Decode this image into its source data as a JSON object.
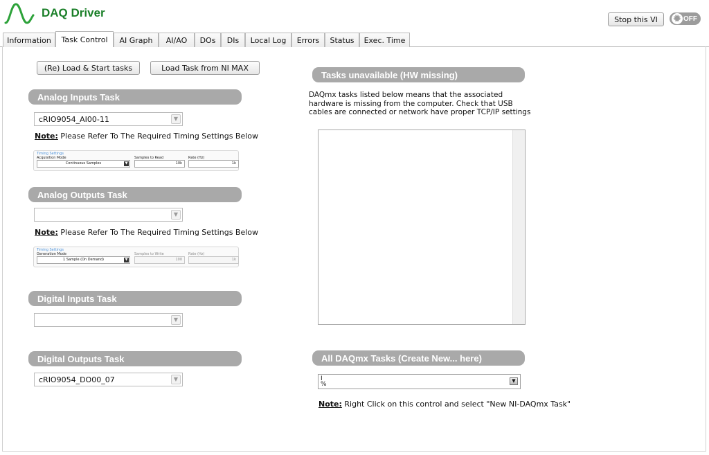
{
  "header": {
    "title": "DAQ Driver",
    "stop_button": "Stop this VI",
    "power_toggle": "OFF"
  },
  "tabs": [
    {
      "label": "Information"
    },
    {
      "label": "Task Control",
      "active": true
    },
    {
      "label": "AI Graph"
    },
    {
      "label": "AI/AO"
    },
    {
      "label": "DOs"
    },
    {
      "label": "DIs"
    },
    {
      "label": "Local Log"
    },
    {
      "label": "Errors"
    },
    {
      "label": "Status"
    },
    {
      "label": "Exec. Time"
    }
  ],
  "toolbar": {
    "load_start": "(Re) Load & Start tasks",
    "load_nimax": "Load Task from NI MAX"
  },
  "analog_inputs": {
    "title": "Analog Inputs Task",
    "selected": "cRIO9054_AI00-11",
    "note_prefix": "Note:",
    "note_text": "Please Refer To The Required Timing Settings Below",
    "timing": {
      "title": "Timing Settings",
      "mode_label": "Acquisition Mode",
      "mode_value": "Continuous Samples",
      "samples_label": "Samples to Read",
      "samples_value": "10k",
      "rate_label": "Rate (Hz)",
      "rate_value": "1k"
    }
  },
  "analog_outputs": {
    "title": "Analog Outputs Task",
    "selected": "",
    "note_prefix": "Note:",
    "note_text": "Please Refer To The Required Timing Settings Below",
    "timing": {
      "title": "Timing Settings",
      "mode_label": "Generation Mode",
      "mode_value": "1 Sample (On Demand)",
      "samples_label": "Samples to Write",
      "samples_value": "100",
      "rate_label": "Rate (Hz)",
      "rate_value": "1k"
    }
  },
  "digital_inputs": {
    "title": "Digital Inputs Task",
    "selected": ""
  },
  "digital_outputs": {
    "title": "Digital Outputs Task",
    "selected": "cRIO9054_DO00_07"
  },
  "unavailable": {
    "title": "Tasks unavailable (HW missing)",
    "description": "DAQmx tasks listed below means that the associated hardware is missing from the computer. Check that USB cables are connected or network have proper TCP/IP settings"
  },
  "all_tasks": {
    "title": "All DAQmx Tasks (Create New... here)",
    "value": "",
    "note_prefix": "Note:",
    "note_text": "Right Click on this control and select \"New NI-DAQmx Task\""
  },
  "colors": {
    "brand_green": "#1a7f28",
    "section_header": "#a9a9a9"
  },
  "icons": {
    "logo": "waveform-logo",
    "power": "gear-icon",
    "dropdown": "chevron-down-icon",
    "io_name": "io-name-icon"
  }
}
